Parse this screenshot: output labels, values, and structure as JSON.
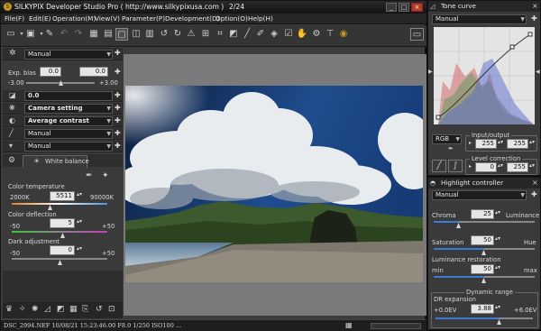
{
  "window": {
    "title": "SILKYPIX Developer Studio Pro ( http://www.silkypixusa.com )",
    "counter": "2/24"
  },
  "menu": [
    "File(F)",
    "Edit(E)",
    "Operation(M)",
    "View(V)",
    "Parameter(P)",
    "Development(D)",
    "Option(O)",
    "Help(H)"
  ],
  "left": {
    "preset": "Manual",
    "exp": {
      "label": "Exp. bias",
      "v1": "0.0",
      "v2": "0.0",
      "min": "-3.00",
      "max": "+3.00"
    },
    "wb_value": "0.0",
    "camera": "Camera setting",
    "contrast": "Average contrast",
    "sharp": "Manual",
    "noise": "Manual",
    "wb_tab": "White balance",
    "ct": {
      "label": "Color temperature",
      "min": "2000K",
      "value": "5511",
      "max": "90000K"
    },
    "cd": {
      "label": "Color deflection",
      "min": "-50",
      "value": "5",
      "max": "+50"
    },
    "da": {
      "label": "Dark adjustment",
      "min": "-50",
      "value": "0",
      "max": "+50"
    }
  },
  "status": "DSC_2994.NEF 10/08/21 15:23:46.00 F8.0 1/250 ISO100 ...",
  "tone": {
    "title": "Tone curve",
    "preset": "Manual",
    "channel": "RGB",
    "io_title": "Input/output",
    "in": "255",
    "out": "255",
    "lc_title": "Level correction",
    "lc_in": "0",
    "lc_out": "255"
  },
  "hl": {
    "title": "Highlight controller",
    "preset": "Manual",
    "chroma": "Chroma",
    "chroma_v": "25",
    "lum": "Luminance",
    "sat": "Saturation",
    "sat_v": "50",
    "hue": "Hue",
    "lr": "Luminance restoration",
    "lr_min": "min",
    "lr_v": "50",
    "lr_max": "max",
    "dr_title": "Dynamic range",
    "dr": "DR expansion",
    "dr_min": "+0.0EV",
    "dr_v": "3.88",
    "dr_max": "+6.0EV"
  },
  "colors": {
    "accent": "#3a7bd5",
    "ct_track": "#4a8fd8",
    "cd_track": "#c040c0"
  },
  "icons": [
    "open-folder-icon",
    "save-icon",
    "undo-icon",
    "redo-icon",
    "grid-view-icon",
    "single-view-icon",
    "compare-icon",
    "rotate-left-icon",
    "rotate-right-icon",
    "warning-icon",
    "crop-icon",
    "straighten-icon",
    "dropper-icon",
    "ok-icon",
    "hand-icon",
    "spot-icon",
    "print-icon",
    "silkypix-icon"
  ]
}
